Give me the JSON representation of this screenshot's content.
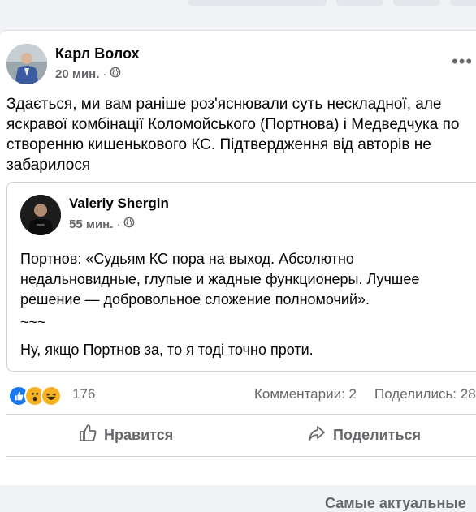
{
  "post": {
    "author": "Карл Волох",
    "time": "20 мин.",
    "text": "Здається, ми вам раніше роз'яснювали суть нескладної, але яскравої комбінації Коломойського (Портнова) і Медведчука по створенню кишенькового КС. Підтвердження від авторів не забарилося"
  },
  "shared": {
    "author": "Valeriy Shergin",
    "time": "55 мин.",
    "text": "Портнов: «Судьям КС пора на выход. Абсолютно недальновидные, глупые и жадные функционеры. Лучшее решение — добровольное сложение полномочий».",
    "separator": "~~~",
    "last_line": "Ну, якщо Портнов за, то я тоді точно проти."
  },
  "stats": {
    "reactions_count": "176",
    "comments": "Комментарии: 2",
    "shares": "Поделились: 28"
  },
  "actions": {
    "like": "Нравится",
    "share": "Поделиться"
  },
  "sort_label": "Самые актуальные"
}
